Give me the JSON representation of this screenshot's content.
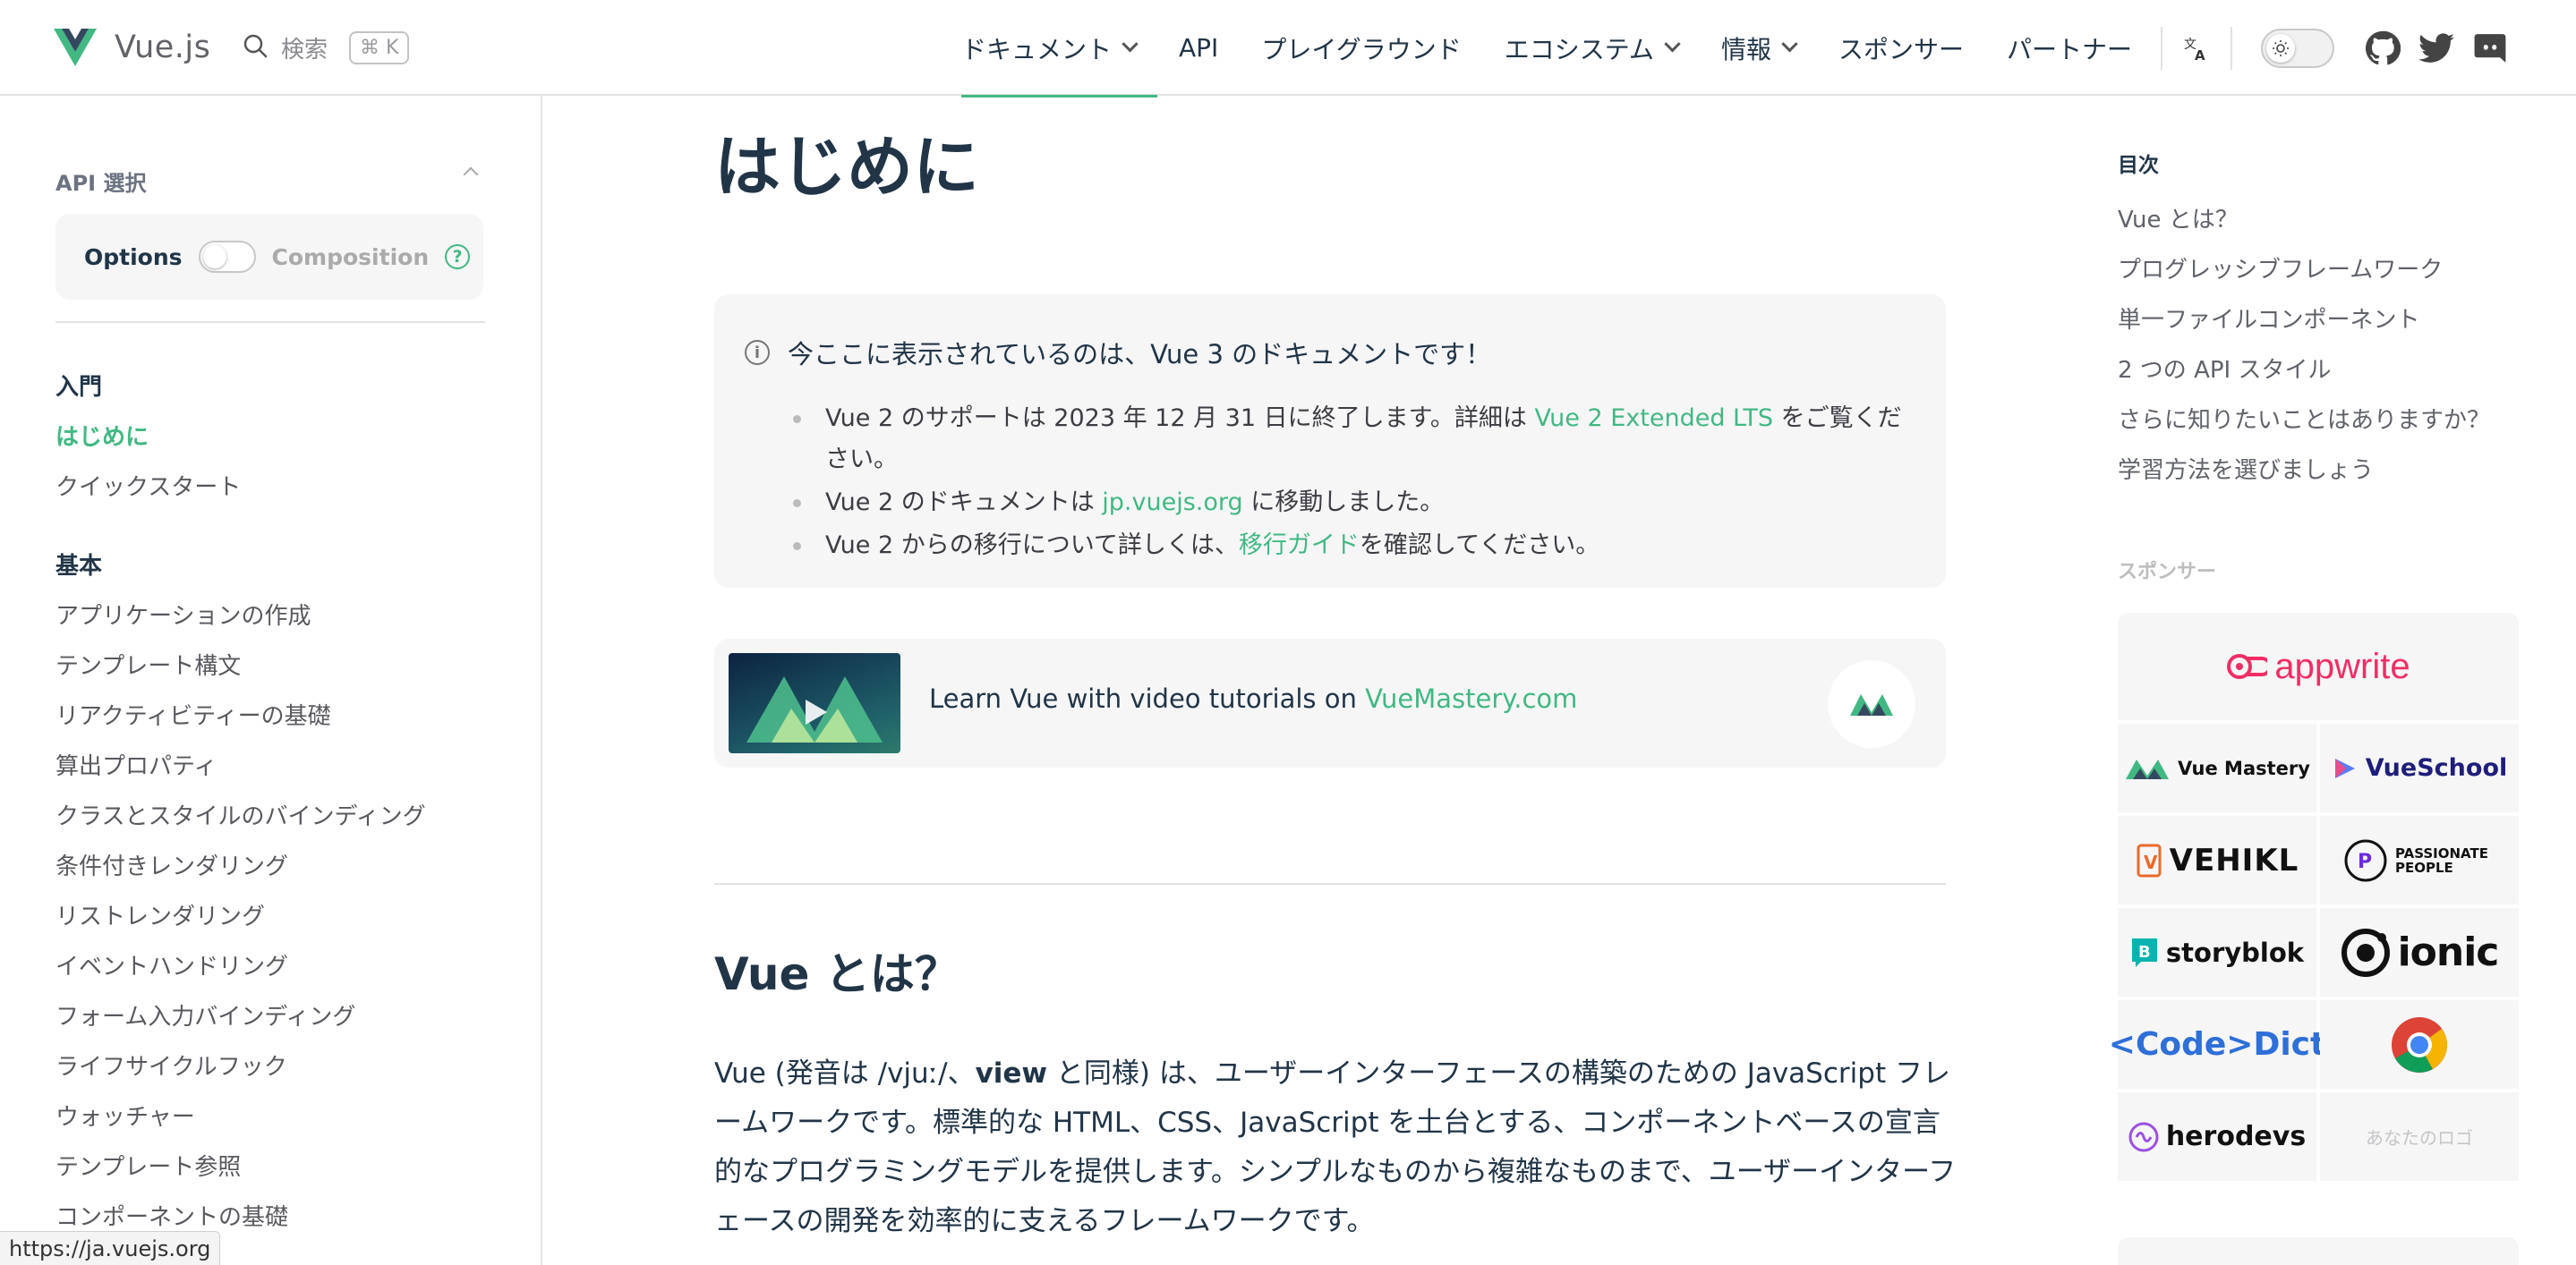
{
  "nav": {
    "brand": "Vue.js",
    "search_label": "検索",
    "search_shortcut": "⌘ K",
    "menu": [
      {
        "label": "ドキュメント",
        "dropdown": true,
        "active": true
      },
      {
        "label": "API",
        "dropdown": false
      },
      {
        "label": "プレイグラウンド",
        "dropdown": false
      },
      {
        "label": "エコシステム",
        "dropdown": true
      },
      {
        "label": "情報",
        "dropdown": true
      },
      {
        "label": "スポンサー",
        "dropdown": false
      },
      {
        "label": "パートナー",
        "dropdown": false
      }
    ],
    "icons": [
      "translate-icon",
      "theme-toggle",
      "github-icon",
      "twitter-icon",
      "discord-icon"
    ]
  },
  "sidebar": {
    "api_title": "API 選択",
    "api_options": "Options",
    "api_composition": "Composition",
    "help": "?",
    "sections": [
      {
        "title": "入門",
        "items": [
          "はじめに",
          "クイックスタート"
        ],
        "active": "はじめに"
      },
      {
        "title": "基本",
        "items": [
          "アプリケーションの作成",
          "テンプレート構文",
          "リアクティビティーの基礎",
          "算出プロパティ",
          "クラスとスタイルのバインディング",
          "条件付きレンダリング",
          "リストレンダリング",
          "イベントハンドリング",
          "フォーム入力バインディング",
          "ライフサイクルフック",
          "ウォッチャー",
          "テンプレート参照",
          "コンポーネントの基礎"
        ]
      }
    ]
  },
  "status_url": "https://ja.vuejs.org",
  "main": {
    "title": "はじめに",
    "info": {
      "title": "今ここに表示されているのは、Vue 3 のドキュメントです！",
      "b1_pre": "Vue 2 のサポートは 2023 年 12 月 31 日に終了します。詳細は ",
      "b1_link": "Vue 2 Extended LTS",
      "b1_post": " をご覧ください。",
      "b2_pre": "Vue 2 のドキュメントは ",
      "b2_link": "jp.vuejs.org",
      "b2_post": " に移動しました。",
      "b3_pre": "Vue 2 からの移行について詳しくは、",
      "b3_link": "移行ガイド",
      "b3_post": "を確認してください。"
    },
    "banner": {
      "text_pre": "Learn Vue with video tutorials on ",
      "text_link": "VueMastery.com"
    },
    "h2": "Vue とは？",
    "para_pre": "Vue (発音は /vjuː/、",
    "para_bold": "view",
    "para_post": " と同様) は、ユーザーインターフェースの構築のための JavaScript フレームワークです。標準的な HTML、CSS、JavaScript を土台とする、コンポーネントベースの宣言的なプログラミングモデルを提供します。シンプルなものから複雑なものまで、ユーザーインターフェースの開発を効率的に支えるフレームワークです。"
  },
  "aside": {
    "toc_title": "目次",
    "toc": [
      "Vue とは？",
      "プログレッシブフレームワーク",
      "単一ファイルコンポーネント",
      "2 つの API スタイル",
      "さらに知りたいことはありますか？",
      "学習方法を選びましょう"
    ],
    "sponsors_title": "スポンサー",
    "sponsors": {
      "appwrite": "appwrite",
      "vuemastery": "Vue Mastery",
      "vueschool": "VueSchool",
      "vehikl": "VEHIKL",
      "passionate": "PASSIONATE PEOPLE",
      "storyblok": "storyblok",
      "ionic": "ionic",
      "codedict": "<Code>Dict",
      "herodevs": "herodevs",
      "your_logo": "あなたのロゴ"
    }
  },
  "colors": {
    "accent": "#42b883",
    "text": "#213547",
    "muted": "#f6f6f7",
    "appwrite": "#f02e65",
    "vueschool": "#1e1e7a"
  }
}
